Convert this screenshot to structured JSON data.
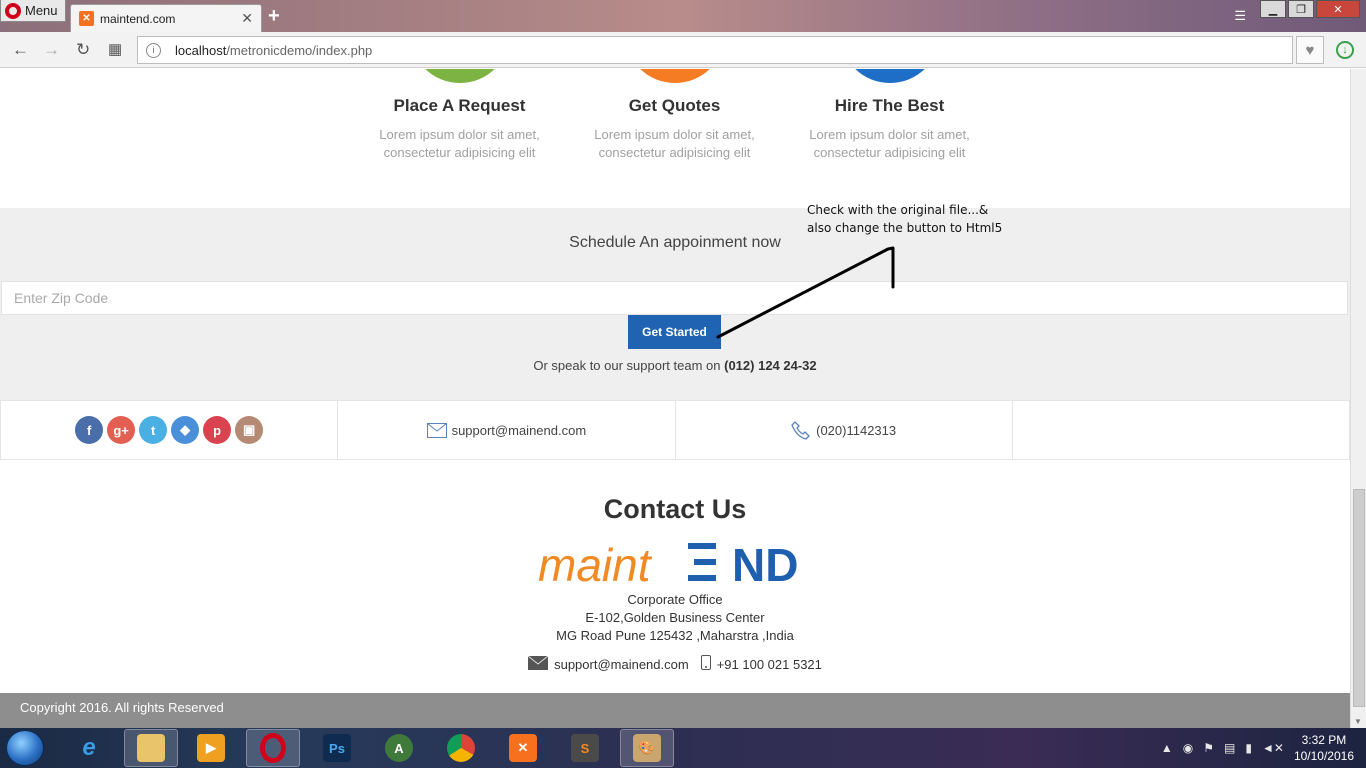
{
  "browser": {
    "menu_label": "Menu",
    "tab_title": "maintend.com",
    "url_host": "localhost",
    "url_path": "/metronicdemo/index.php"
  },
  "steps": [
    {
      "title": "Place A Request",
      "desc": "Lorem ipsum dolor sit amet, consectetur adipisicing elit",
      "color": "#7cb342"
    },
    {
      "title": "Get Quotes",
      "desc": "Lorem ipsum dolor sit amet, consectetur adipisicing elit",
      "color": "#f57c22"
    },
    {
      "title": "Hire The Best",
      "desc": "Lorem ipsum dolor sit amet, consectetur adipisicing elit",
      "color": "#1e6ec8"
    }
  ],
  "schedule": {
    "title": "Schedule An appoinment now",
    "zip_placeholder": "Enter Zip Code",
    "button_label": "Get Started",
    "support_prefix": "Or speak to our support team on",
    "support_phone": "(012) 124 24-32"
  },
  "contact_strip": {
    "social_icons": [
      "facebook-icon",
      "google-plus-icon",
      "twitter-icon",
      "dropbox-icon",
      "pinterest-icon",
      "instagram-icon"
    ],
    "email": "support@mainend.com",
    "phone": "(020)1142313"
  },
  "contact": {
    "heading": "Contact Us",
    "logo_left": "maint",
    "logo_right": "ND",
    "office_label": "Corporate Office",
    "address_line1": "E-102,Golden Business Center",
    "address_line2": "MG Road Pune 125432 ,Maharstra ,India",
    "email": "support@mainend.com",
    "mobile": "+91 100 021 5321"
  },
  "footer": {
    "copyright": "Copyright 2016. All rights Reserved"
  },
  "annotation": {
    "line1": "Check with the original file...&",
    "line2": "also change the button to Html5"
  },
  "taskbar": {
    "time": "3:32 PM",
    "date": "10/10/2016"
  },
  "colors": {
    "primary_blue": "#2163b3",
    "logo_orange": "#f08a24",
    "logo_blue": "#1f5fb0",
    "footer_gray": "#8e8e8e"
  }
}
